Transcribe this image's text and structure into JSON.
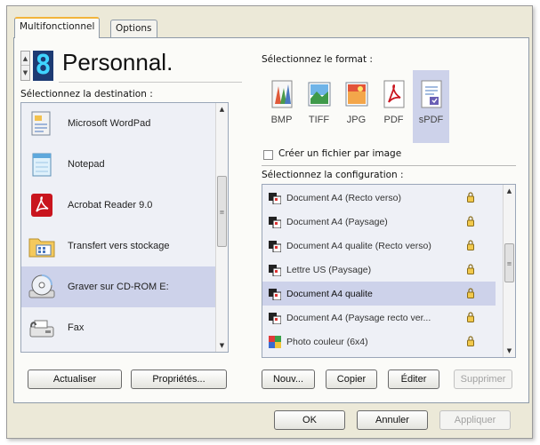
{
  "tabs": [
    {
      "label": "Multifonctionnel",
      "active": true
    },
    {
      "label": "Options",
      "active": false
    }
  ],
  "profile": {
    "digit": "8",
    "name": "Personnal."
  },
  "destination": {
    "label": "Sélectionnez la destination :",
    "items": [
      {
        "label": "Microsoft WordPad",
        "icon": "wordpad-icon",
        "selected": false
      },
      {
        "label": "Notepad",
        "icon": "notepad-icon",
        "selected": false
      },
      {
        "label": "Acrobat Reader 9.0",
        "icon": "acrobat-icon",
        "selected": false
      },
      {
        "label": "Transfert vers stockage",
        "icon": "storage-folder-icon",
        "selected": false
      },
      {
        "label": "Graver sur CD-ROM  E:",
        "icon": "cd-burn-icon",
        "selected": true
      },
      {
        "label": "Fax",
        "icon": "fax-icon",
        "selected": false
      }
    ]
  },
  "format": {
    "label": "Sélectionnez le format :",
    "items": [
      {
        "label": "BMP",
        "icon": "bmp-format-icon",
        "selected": false
      },
      {
        "label": "TIFF",
        "icon": "tiff-format-icon",
        "selected": false
      },
      {
        "label": "JPG",
        "icon": "jpg-format-icon",
        "selected": false
      },
      {
        "label": "PDF",
        "icon": "pdf-format-icon",
        "selected": false
      },
      {
        "label": "sPDF",
        "icon": "spdf-format-icon",
        "selected": true
      }
    ],
    "one_file_per_image": {
      "label": "Créer un fichier par image",
      "checked": false
    }
  },
  "configuration": {
    "label": "Sélectionnez la configuration :",
    "items": [
      {
        "label": "Document A4 (Recto verso)",
        "icon": "color-document-icon",
        "selected": false
      },
      {
        "label": "Document A4 (Paysage)",
        "icon": "color-document-icon",
        "selected": false
      },
      {
        "label": "Document A4 qualite (Recto verso)",
        "icon": "color-document-icon",
        "selected": false
      },
      {
        "label": "Lettre US (Paysage)",
        "icon": "color-document-icon",
        "selected": false
      },
      {
        "label": "Document A4 qualite",
        "icon": "color-document-icon",
        "selected": true
      },
      {
        "label": "Document A4 (Paysage recto ver...",
        "icon": "color-document-icon",
        "selected": false
      },
      {
        "label": "Photo couleur (6x4)",
        "icon": "photo-icon",
        "selected": false
      }
    ]
  },
  "buttons": {
    "refresh": "Actualiser",
    "properties": "Propriétés...",
    "new": "Nouv...",
    "copy": "Copier",
    "edit": "Éditer",
    "delete": "Supprimer",
    "ok": "OK",
    "cancel": "Annuler",
    "apply": "Appliquer"
  },
  "colors": {
    "selection": "#cdd2ea",
    "tab_accent": "#f2b43c",
    "digit_bg": "#1d3b73",
    "digit_fg": "#3fd4ff"
  }
}
